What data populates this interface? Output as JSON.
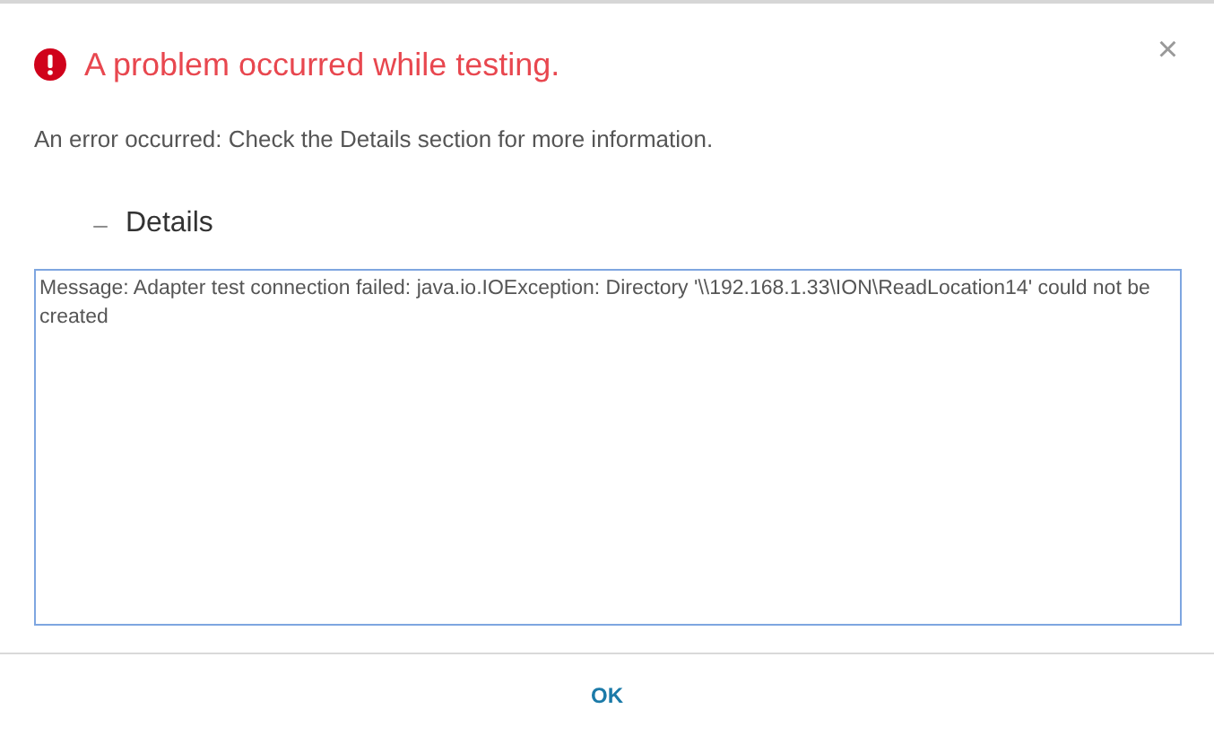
{
  "dialog": {
    "title": "A problem occurred while testing.",
    "close": "×",
    "message": "An error occurred: Check the Details section for more information.",
    "details": {
      "toggle": "–",
      "label": "Details",
      "text": "Message: Adapter test connection failed: java.io.IOException: Directory '\\\\192.168.1.33\\ION\\ReadLocation14' could not be created"
    },
    "buttons": [
      "OK"
    ]
  }
}
